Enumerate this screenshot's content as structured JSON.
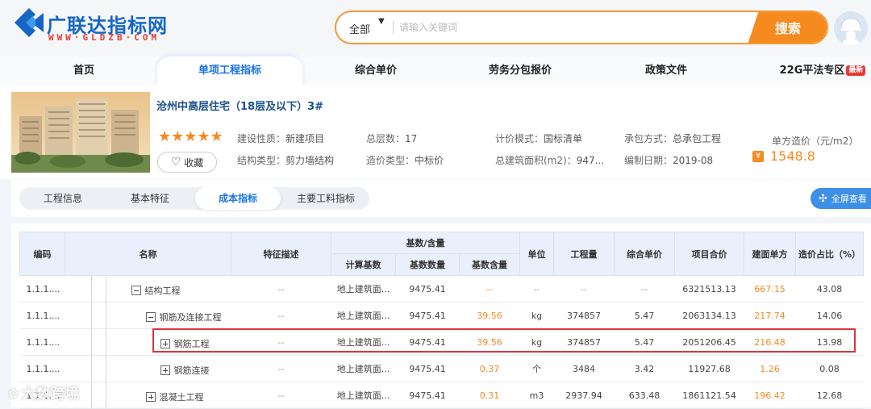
{
  "logo": {
    "title": "广联达指标网",
    "subtitle": "WWW·GLDZB·COM"
  },
  "search": {
    "scope": "全部",
    "placeholder": "请输入关键词",
    "button": "搜索"
  },
  "nav": {
    "items": [
      "首页",
      "单项工程指标",
      "综合单价",
      "劳务分包报价",
      "政策文件",
      "22G平法专区"
    ],
    "badge": "最新",
    "active": "单项工程指标"
  },
  "project": {
    "title": "沧州中高层住宅（18层及以下）3#",
    "rating": 5,
    "stars": "★★★★★",
    "favorite": "收藏",
    "meta": [
      {
        "label": "建设性质：",
        "value": "新建项目"
      },
      {
        "label": "总层数：",
        "value": "17"
      },
      {
        "label": "计价模式：",
        "value": "国标清单"
      },
      {
        "label": "承包方式：",
        "value": "总承包工程"
      },
      {
        "label": "结构类型：",
        "value": "剪力墙结构"
      },
      {
        "label": "造价类型：",
        "value": "中标价"
      },
      {
        "label": "总建筑面积(m2)：",
        "value": "947..."
      },
      {
        "label": "编制日期：",
        "value": "2019-08"
      }
    ],
    "unit_price_label": "单方造价（元/m2）",
    "unit_price": "1548.8",
    "price_icon": "¥"
  },
  "tabs": {
    "items": [
      "工程信息",
      "基本特征",
      "成本指标",
      "主要工料指标"
    ],
    "active": "成本指标",
    "fullscreen": "全屏查看"
  },
  "table": {
    "headers": {
      "code": "编码",
      "name": "名称",
      "feature": "特征描述",
      "base_group": "基数/含量",
      "calc_base": "计算基数",
      "base_qty": "基数数量",
      "base_content": "基数含量",
      "unit": "单位",
      "quantity": "工程量",
      "unit_price": "综合单价",
      "total": "项目合价",
      "area_price": "建面单方",
      "ratio": "造价占比（%）"
    },
    "rows": [
      {
        "code": "1.1.1....",
        "name": "结构工程",
        "level": 0,
        "box": "minus",
        "feature": "--",
        "calc_base": "地上建筑面...",
        "base_qty": "9475.41",
        "base_content": "--",
        "unit": "--",
        "quantity": "--",
        "unit_price": "--",
        "total": "6321513.13",
        "area_price": "667.15",
        "ratio": "43.08"
      },
      {
        "code": "1.1.1....",
        "name": "钢筋及连接工程",
        "level": 1,
        "box": "minus",
        "feature": "--",
        "calc_base": "地上建筑面...",
        "base_qty": "9475.41",
        "base_content": "39.56",
        "unit": "kg",
        "quantity": "374857",
        "unit_price": "5.47",
        "total": "2063134.13",
        "area_price": "217.74",
        "ratio": "14.06"
      },
      {
        "code": "1.1.1....",
        "name": "钢筋工程",
        "level": 2,
        "box": "plus",
        "feature": "--",
        "calc_base": "地上建筑面...",
        "base_qty": "9475.41",
        "base_content": "39.56",
        "unit": "kg",
        "quantity": "374857",
        "unit_price": "5.47",
        "total": "2051206.45",
        "area_price": "216.48",
        "ratio": "13.98"
      },
      {
        "code": "1.1.1....",
        "name": "钢筋连接",
        "level": 2,
        "box": "plus",
        "feature": "--",
        "calc_base": "地上建筑面...",
        "base_qty": "9475.41",
        "base_content": "0.37",
        "unit": "个",
        "quantity": "3484",
        "unit_price": "3.42",
        "total": "11927.68",
        "area_price": "1.26",
        "ratio": "0.08"
      },
      {
        "code": "1.1.1....",
        "name": "混凝土工程",
        "level": 1,
        "box": "plus",
        "feature": "--",
        "calc_base": "地上建筑面...",
        "base_qty": "9475.41",
        "base_content": "0.31",
        "unit": "m3",
        "quantity": "2937.94",
        "unit_price": "633.48",
        "total": "1861121.54",
        "area_price": "196.42",
        "ratio": "12.68"
      }
    ]
  },
  "watermark": "大数跨境",
  "colors": {
    "accent": "#1a73e8",
    "orange": "#f58a1f",
    "highlight": "#d9363e"
  }
}
